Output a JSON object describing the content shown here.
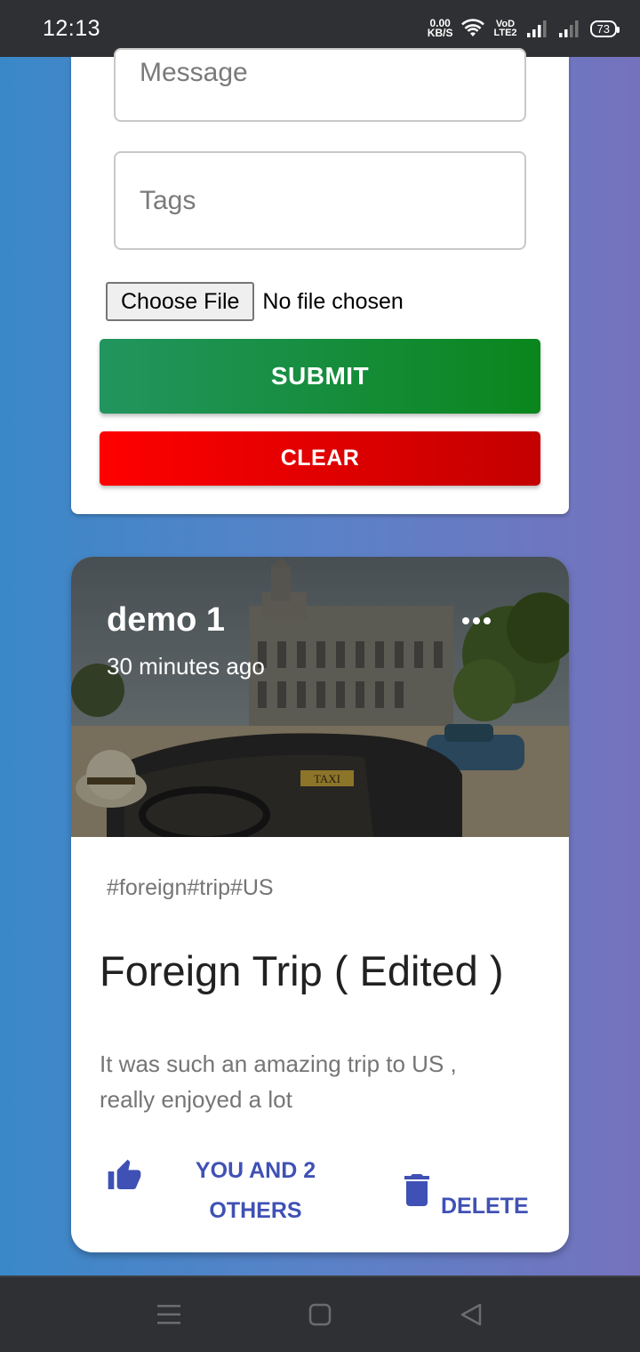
{
  "status_bar": {
    "time": "12:13",
    "net_speed_value": "0.00",
    "net_speed_unit": "KB/S",
    "volte_top": "VoD",
    "volte_bottom": "LTE2",
    "battery": "73"
  },
  "form": {
    "message_placeholder": "Message",
    "tags_placeholder": "Tags",
    "file_button_label": "Choose File",
    "file_status": "No file chosen",
    "submit_label": "SUBMIT",
    "clear_label": "CLEAR",
    "submit_colors": [
      "#22955f",
      "#0a861c"
    ],
    "clear_colors": [
      "#ff0000",
      "#c30000"
    ]
  },
  "post": {
    "author": "demo 1",
    "time_ago": "30 minutes ago",
    "tags": "#foreign#trip#US",
    "title": "Foreign Trip ( Edited )",
    "body": "It was such an amazing trip to US , really enjoyed a lot",
    "like_label_line1": "YOU AND 2",
    "like_label_line2": "OTHERS",
    "delete_label": "DELETE",
    "action_color": "#3f51b5",
    "image_text": "TAXI"
  },
  "nav_bar": {
    "items": [
      "menu-icon",
      "home-icon",
      "back-icon"
    ]
  }
}
